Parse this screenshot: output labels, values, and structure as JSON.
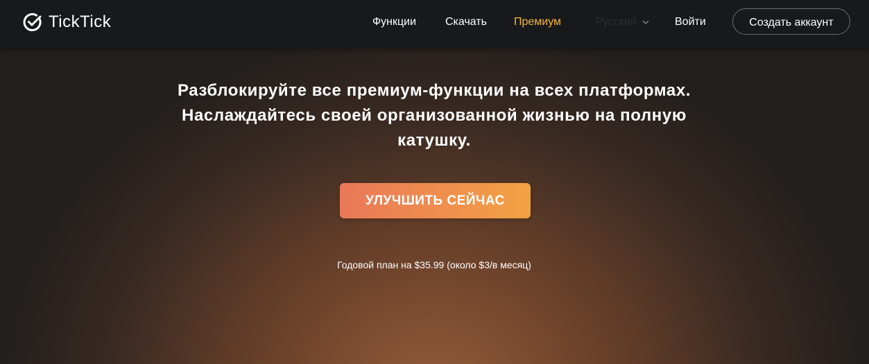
{
  "brand": {
    "name": "TickTick",
    "logo_icon": "check-circle-icon"
  },
  "nav": {
    "features": "Функции",
    "download": "Скачать",
    "premium": "Премиум",
    "language": "Русский",
    "login": "Войти",
    "signup": "Создать аккаунт",
    "language_icon": "chevron-down-icon"
  },
  "hero": {
    "headline": "Разблокируйте все премиум-функции на всех платформах. Наслаждайтесь своей организованной жизнью на полную катушку.",
    "cta_label": "УЛУЧШИТЬ СЕЙЧАС",
    "plan_text": "Годовой план на $35.99 (около $3/в месяц)"
  },
  "colors": {
    "navbar": "#18191a",
    "premium_link": "#f5b73b",
    "cta_start": "#ea7858",
    "cta_end": "#f1a243",
    "hero_glow": "#935b38"
  }
}
